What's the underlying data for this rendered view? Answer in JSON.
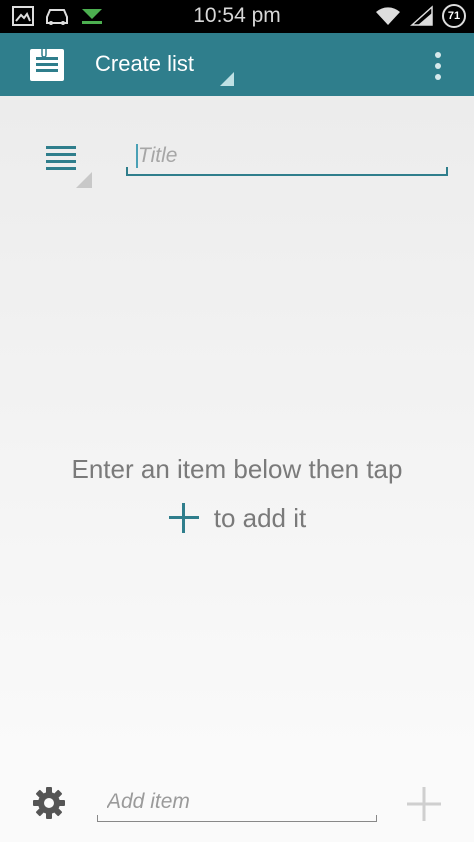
{
  "status_bar": {
    "time": "10:54 pm",
    "battery": "71",
    "icons": [
      "image-icon",
      "car-icon",
      "download-arrow-icon",
      "wifi-icon",
      "signal-icon",
      "battery-icon"
    ]
  },
  "app_bar": {
    "title": "Create list",
    "icon": "clipboard-list-icon",
    "menu_icon": "overflow-menu-icon"
  },
  "form": {
    "title_placeholder": "Title",
    "title_value": ""
  },
  "empty_state": {
    "line1": "Enter an item below then tap",
    "line2": "to add it",
    "plus_icon": "plus-icon"
  },
  "bottom": {
    "add_item_placeholder": "Add item",
    "settings_icon": "gear-icon",
    "add_icon": "plus-icon"
  },
  "colors": {
    "accent": "#2f7e8c",
    "status_bar": "#000000",
    "background": "#ececec"
  }
}
